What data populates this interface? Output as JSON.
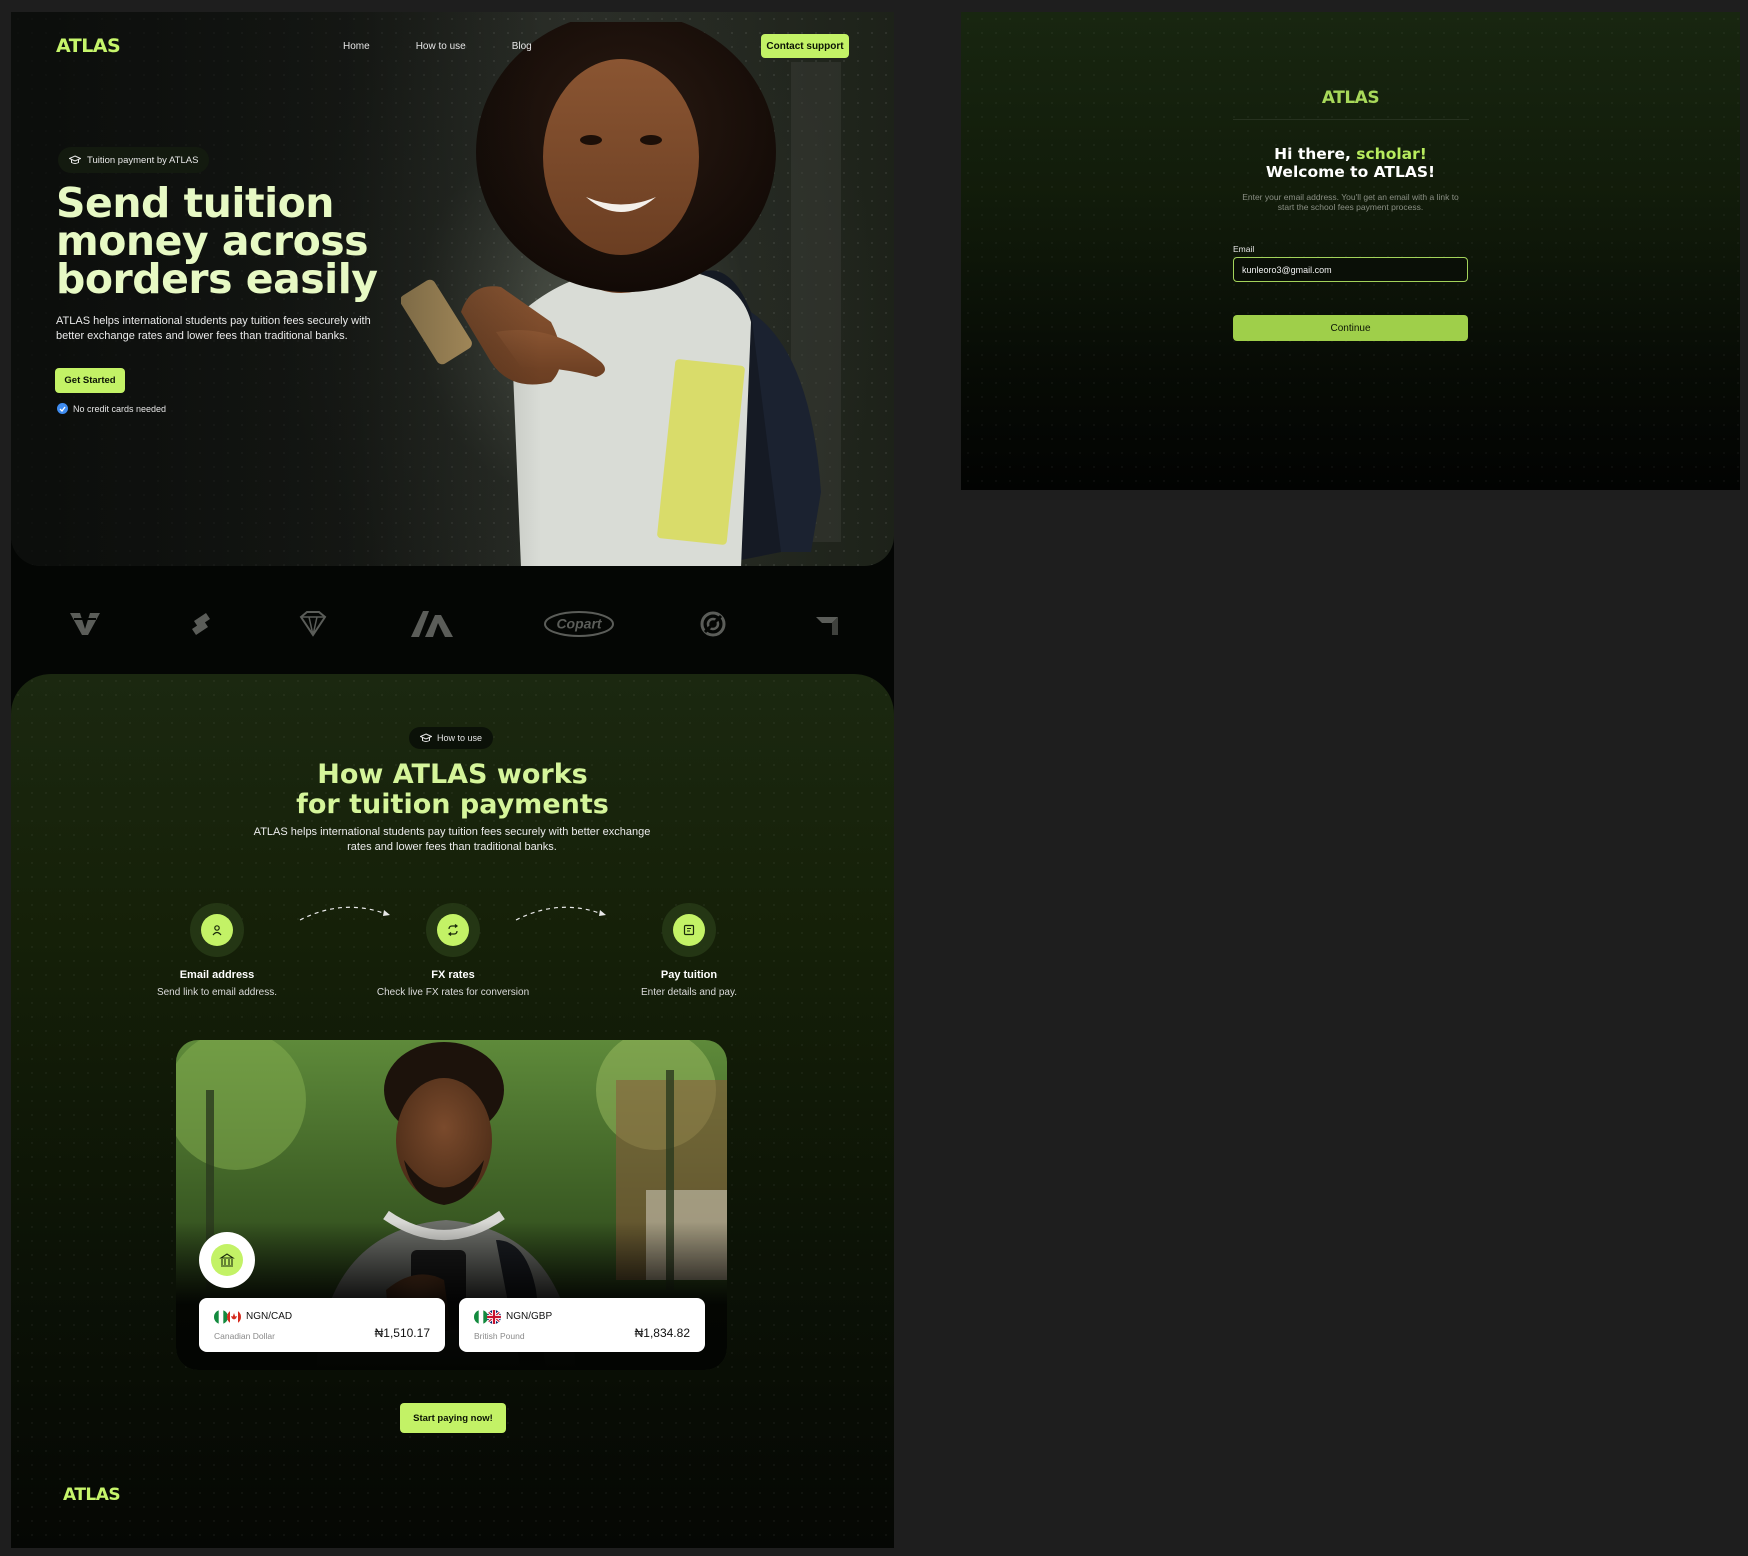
{
  "landing": {
    "nav": {
      "logo": "ATLAS",
      "links": [
        "Home",
        "How to use",
        "Blog"
      ],
      "contact_label": "Contact support"
    },
    "hero": {
      "badge": "Tuition payment by ATLAS",
      "title_lines": [
        "Send tuition",
        "money across",
        "borders easily"
      ],
      "description": "ATLAS helps international students pay tuition fees securely with better exchange rates and lower fees than traditional banks.",
      "cta_label": "Get Started",
      "note": "No credit cards needed"
    },
    "partner_logos": [
      "v-logo-icon",
      "s-logo-icon",
      "diamond-logo-icon",
      "aa-logo-icon",
      "copart-logo-icon",
      "circle-logo-icon",
      "block-logo-icon"
    ],
    "partner_text": {
      "copart": "Copart"
    },
    "how": {
      "badge": "How to use",
      "title_lines": [
        "How ATLAS works",
        "for tuition payments"
      ],
      "description": "ATLAS helps international students pay tuition fees securely with better exchange rates and lower fees than traditional banks.",
      "steps": [
        {
          "title": "Email address",
          "subtitle": "Send link to email address.",
          "icon": "user-icon"
        },
        {
          "title": "FX rates",
          "subtitle": "Check live FX rates for conversion",
          "icon": "exchange-icon"
        },
        {
          "title": "Pay tuition",
          "subtitle": "Enter details and pay.",
          "icon": "receipt-icon"
        }
      ],
      "rates": [
        {
          "pair": "NGN/CAD",
          "name": "Canadian Dollar",
          "value": "₦1,510.17"
        },
        {
          "pair": "NGN/GBP",
          "name": "British Pound",
          "value": "₦1,834.82"
        }
      ],
      "cta_label": "Start paying now!"
    },
    "footer": {
      "logo": "ATLAS"
    }
  },
  "login": {
    "logo": "ATLAS",
    "greeting_prefix": "Hi there, ",
    "greeting_accent": "scholar!",
    "greeting_line2": "Welcome to ATLAS!",
    "subtitle": "Enter your email address. You'll get an email with a link to start the school fees payment process.",
    "email_label": "Email",
    "email_value": "kunleoro3@gmail.com",
    "continue_label": "Continue"
  },
  "colors": {
    "accent": "#c3f266",
    "headline": "#e7f9c4",
    "page_bg": "#1e1e1e"
  }
}
